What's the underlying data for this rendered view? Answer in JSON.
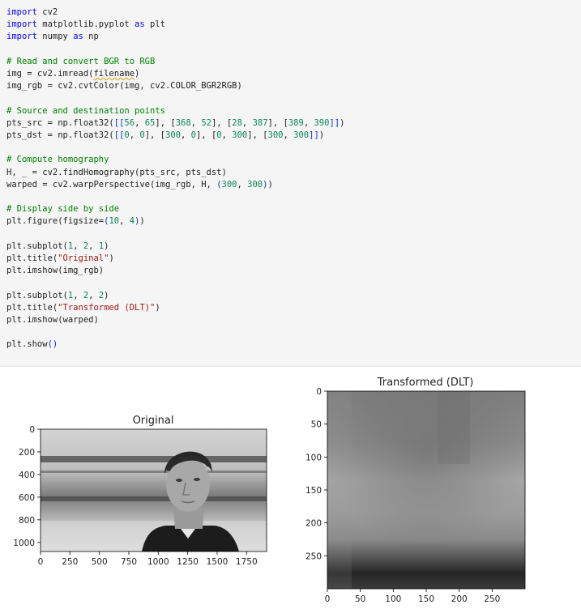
{
  "code_lines": [
    {
      "tokens": [
        {
          "t": "import",
          "c": "k"
        },
        {
          "t": " cv2"
        }
      ]
    },
    {
      "tokens": [
        {
          "t": "import",
          "c": "k"
        },
        {
          "t": " matplotlib.pyplot "
        },
        {
          "t": "as",
          "c": "k"
        },
        {
          "t": " plt"
        }
      ]
    },
    {
      "tokens": [
        {
          "t": "import",
          "c": "k"
        },
        {
          "t": " numpy "
        },
        {
          "t": "as",
          "c": "k"
        },
        {
          "t": " np"
        }
      ]
    },
    {
      "tokens": []
    },
    {
      "tokens": [
        {
          "t": "# Read and convert BGR to RGB",
          "c": "c"
        }
      ]
    },
    {
      "tokens": [
        {
          "t": "img = cv2.imread("
        },
        {
          "t": "filename",
          "c": "squiggle"
        },
        {
          "t": ")"
        }
      ]
    },
    {
      "tokens": [
        {
          "t": "img_rgb = cv2.cvtColor(img, cv2.COLOR_BGR2RGB)"
        }
      ]
    },
    {
      "tokens": []
    },
    {
      "tokens": [
        {
          "t": "# Source and destination points",
          "c": "c"
        }
      ]
    },
    {
      "tokens": [
        {
          "t": "pts_src = np.float32("
        },
        {
          "t": "[[",
          "c": "p"
        },
        {
          "t": "56",
          "c": "n"
        },
        {
          "t": ", "
        },
        {
          "t": "65",
          "c": "n"
        },
        {
          "t": "], ["
        },
        {
          "t": "368",
          "c": "n"
        },
        {
          "t": ", "
        },
        {
          "t": "52",
          "c": "n"
        },
        {
          "t": "], ["
        },
        {
          "t": "28",
          "c": "n"
        },
        {
          "t": ", "
        },
        {
          "t": "387",
          "c": "n"
        },
        {
          "t": "], ["
        },
        {
          "t": "389",
          "c": "n"
        },
        {
          "t": ", "
        },
        {
          "t": "390",
          "c": "n"
        },
        {
          "t": "]]",
          "c": "p"
        },
        {
          "t": ")"
        }
      ]
    },
    {
      "tokens": [
        {
          "t": "pts_dst = np.float32("
        },
        {
          "t": "[[",
          "c": "p"
        },
        {
          "t": "0",
          "c": "n"
        },
        {
          "t": ", "
        },
        {
          "t": "0",
          "c": "n"
        },
        {
          "t": "], ["
        },
        {
          "t": "300",
          "c": "n"
        },
        {
          "t": ", "
        },
        {
          "t": "0",
          "c": "n"
        },
        {
          "t": "], ["
        },
        {
          "t": "0",
          "c": "n"
        },
        {
          "t": ", "
        },
        {
          "t": "300",
          "c": "n"
        },
        {
          "t": "], ["
        },
        {
          "t": "300",
          "c": "n"
        },
        {
          "t": ", "
        },
        {
          "t": "300",
          "c": "n"
        },
        {
          "t": "]]",
          "c": "p"
        },
        {
          "t": ")"
        }
      ]
    },
    {
      "tokens": []
    },
    {
      "tokens": [
        {
          "t": "# Compute homography",
          "c": "c"
        }
      ]
    },
    {
      "tokens": [
        {
          "t": "H, _ = cv2.findHomography(pts_src, pts_dst)"
        }
      ]
    },
    {
      "tokens": [
        {
          "t": "warped = cv2.warpPerspective(img_rgb, H, "
        },
        {
          "t": "(",
          "c": "p"
        },
        {
          "t": "300",
          "c": "n"
        },
        {
          "t": ", "
        },
        {
          "t": "300",
          "c": "n"
        },
        {
          "t": ")",
          "c": "p"
        },
        {
          "t": ")"
        }
      ]
    },
    {
      "tokens": []
    },
    {
      "tokens": [
        {
          "t": "# Display side by side",
          "c": "c"
        }
      ]
    },
    {
      "tokens": [
        {
          "t": "plt.figure(figsize="
        },
        {
          "t": "(",
          "c": "p"
        },
        {
          "t": "10",
          "c": "n"
        },
        {
          "t": ", "
        },
        {
          "t": "4",
          "c": "n"
        },
        {
          "t": ")",
          "c": "p"
        },
        {
          "t": ")"
        }
      ]
    },
    {
      "tokens": []
    },
    {
      "tokens": [
        {
          "t": "plt.subplot("
        },
        {
          "t": "1",
          "c": "n"
        },
        {
          "t": ", "
        },
        {
          "t": "2",
          "c": "n"
        },
        {
          "t": ", "
        },
        {
          "t": "1",
          "c": "n"
        },
        {
          "t": ")"
        }
      ]
    },
    {
      "tokens": [
        {
          "t": "plt.title("
        },
        {
          "t": "\"Original\"",
          "c": "s"
        },
        {
          "t": ")"
        }
      ]
    },
    {
      "tokens": [
        {
          "t": "plt.imshow(img_rgb)"
        }
      ]
    },
    {
      "tokens": []
    },
    {
      "tokens": [
        {
          "t": "plt.subplot("
        },
        {
          "t": "1",
          "c": "n"
        },
        {
          "t": ", "
        },
        {
          "t": "2",
          "c": "n"
        },
        {
          "t": ", "
        },
        {
          "t": "2",
          "c": "n"
        },
        {
          "t": ")"
        }
      ]
    },
    {
      "tokens": [
        {
          "t": "plt.title("
        },
        {
          "t": "\"Transformed (DLT)\"",
          "c": "s"
        },
        {
          "t": ")"
        }
      ]
    },
    {
      "tokens": [
        {
          "t": "plt.imshow(warped)"
        }
      ]
    },
    {
      "tokens": []
    },
    {
      "tokens": [
        {
          "t": "plt.show"
        },
        {
          "t": "()",
          "c": "p"
        }
      ]
    }
  ],
  "chart_data": [
    {
      "type": "image",
      "title": "Original",
      "xticks": [
        0,
        250,
        500,
        750,
        1000,
        1250,
        1500,
        1750
      ],
      "yticks": [
        0,
        200,
        400,
        600,
        800,
        1000
      ],
      "xlim": [
        0,
        1920
      ],
      "ylim": [
        1080,
        0
      ],
      "content": "grayscale photo of a man looking upward"
    },
    {
      "type": "image",
      "title": "Transformed (DLT)",
      "xticks": [
        0,
        50,
        100,
        150,
        200,
        250
      ],
      "yticks": [
        0,
        50,
        100,
        150,
        200,
        250
      ],
      "xlim": [
        0,
        300
      ],
      "ylim": [
        300,
        0
      ],
      "content": "blurry warped grayscale image"
    }
  ]
}
